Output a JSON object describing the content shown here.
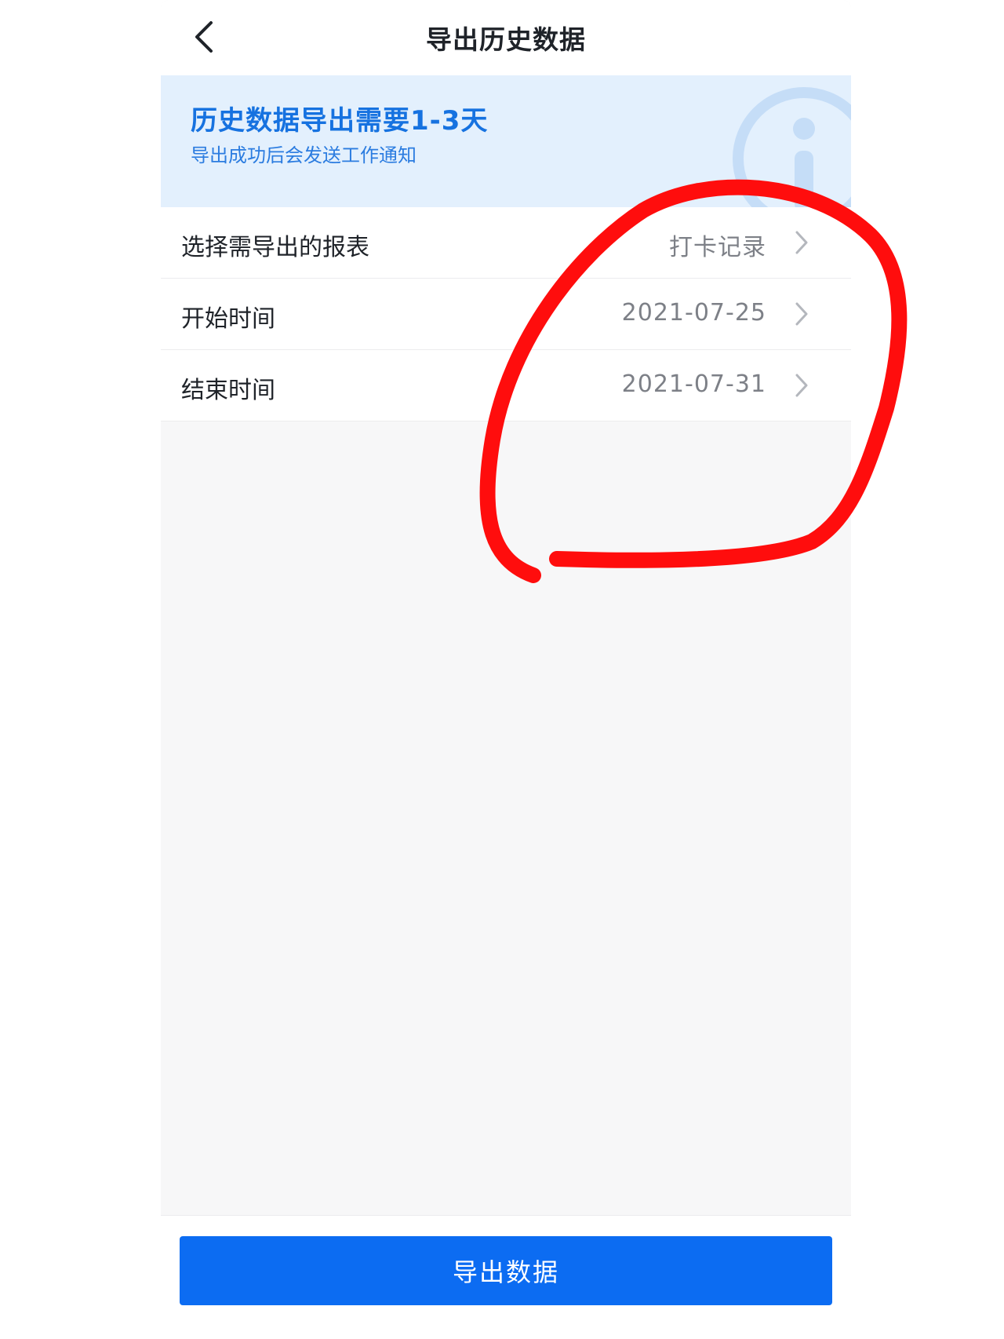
{
  "nav": {
    "title": "导出历史数据",
    "back_icon": "chevron-left-icon"
  },
  "banner": {
    "title": "历史数据导出需要1-3天",
    "subtitle": "导出成功后会发送工作通知",
    "icon": "info-icon"
  },
  "form": {
    "rows": [
      {
        "label": "选择需导出的报表",
        "value": "打卡记录"
      },
      {
        "label": "开始时间",
        "value": "2021-07-25"
      },
      {
        "label": "结束时间",
        "value": "2021-07-31"
      }
    ]
  },
  "footer": {
    "button_label": "导出数据"
  },
  "colors": {
    "primary": "#0c6cf2",
    "banner_bg": "#e3f0fd",
    "banner_text": "#1672e0",
    "annotation": "#ff0d0d"
  }
}
